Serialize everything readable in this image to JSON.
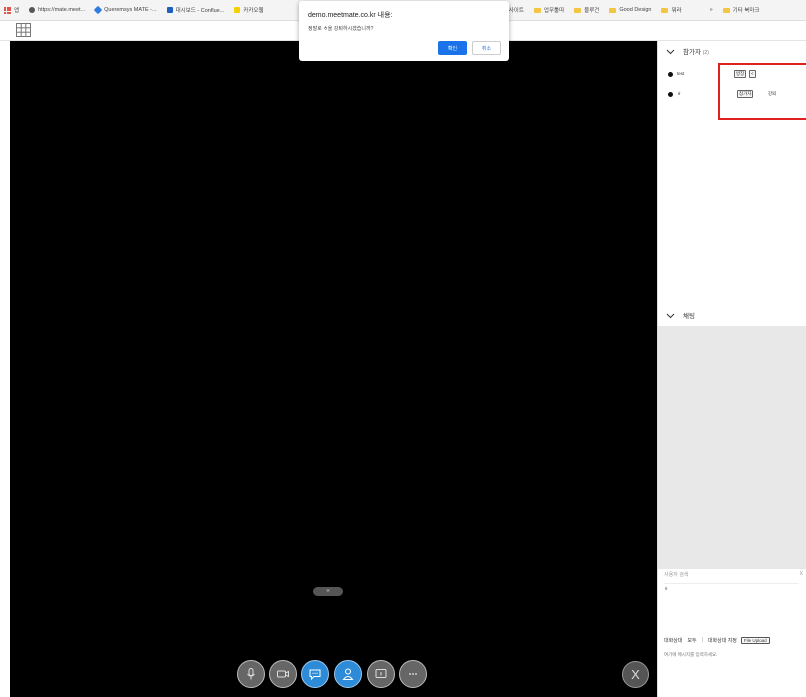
{
  "bookmarks": {
    "items": [
      {
        "label": "앱"
      },
      {
        "label": "https://mate.meet..."
      },
      {
        "label": "Queremsys MATE -..."
      },
      {
        "label": "대시보드 - Conflue..."
      },
      {
        "label": "카카오웹"
      },
      {
        "label": "업무용사이트"
      },
      {
        "label": "업무툴따"
      },
      {
        "label": "블루건"
      },
      {
        "label": "Good Design"
      },
      {
        "label": "뭐라"
      },
      {
        "label": "기타 북마크"
      }
    ],
    "overflow": "»"
  },
  "dialog": {
    "title": "demo.meetmate.co.kr 내용:",
    "message": "정말로 ㅎ을 강퇴하시겠습니까?",
    "ok_label": "확인",
    "cancel_label": "취소"
  },
  "video": {
    "pager_label": "‹‹"
  },
  "controls": [
    {
      "name": "mic",
      "icon": "microphone-icon",
      "active": false
    },
    {
      "name": "camera",
      "icon": "camera-icon",
      "active": false
    },
    {
      "name": "chat",
      "icon": "chat-icon",
      "active": true
    },
    {
      "name": "participants",
      "icon": "person-icon",
      "active": true
    },
    {
      "name": "screen-share",
      "icon": "screen-icon",
      "active": false
    },
    {
      "name": "more",
      "icon": "more-icon",
      "active": false
    }
  ],
  "exit_label": "X",
  "panel": {
    "participants_title": "참가자",
    "participants_count": "(2)",
    "participants": [
      {
        "name": "test",
        "tags": [
          "방장",
          "<"
        ]
      },
      {
        "name": "ㅎ",
        "tags": [
          "참가자"
        ],
        "action": "강퇴"
      }
    ],
    "chat_title": "채팅",
    "search_label": "사용자 검색",
    "search_clear": "X",
    "search_value": "ㅎ",
    "chat_state_label": "대화상대",
    "chat_all_label": "모두",
    "chat_divider": "|",
    "chat_target_label": "대화상대 지정",
    "upload_label": "File Upload",
    "chat_placeholder": "여기에 메시지를 입력하세요."
  },
  "colors": {
    "accent": "#2d8bd8",
    "dialog_button": "#1a73e8",
    "highlight": "#e01f1f",
    "video_bg": "#000000"
  }
}
